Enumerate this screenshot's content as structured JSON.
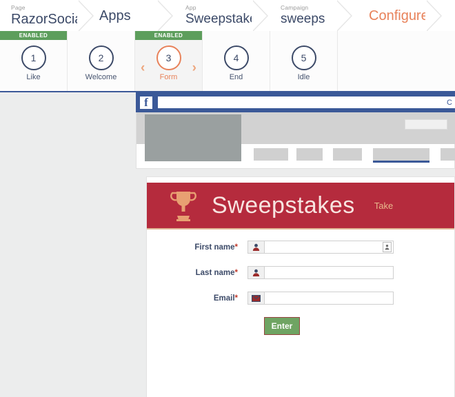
{
  "breadcrumb": {
    "items": [
      {
        "sub": "Page",
        "label": "RazorSocial",
        "style": "normal"
      },
      {
        "sub": "",
        "label": "Apps",
        "style": "normal"
      },
      {
        "sub": "App",
        "label": "Sweepstakes",
        "style": "normal"
      },
      {
        "sub": "Campaign",
        "label": "sweeps",
        "style": "normal"
      },
      {
        "sub": "",
        "label": "Configure",
        "style": "orange"
      }
    ]
  },
  "steps": {
    "enabled_badge": "ENABLED",
    "prev_arrow": "‹",
    "next_arrow": "›",
    "items": [
      {
        "number": "1",
        "label": "Like",
        "enabled": true,
        "active": false
      },
      {
        "number": "2",
        "label": "Welcome",
        "enabled": false,
        "active": false
      },
      {
        "number": "3",
        "label": "Form",
        "enabled": true,
        "active": true
      },
      {
        "number": "4",
        "label": "End",
        "enabled": false,
        "active": false
      },
      {
        "number": "5",
        "label": "Idle",
        "enabled": false,
        "active": false
      }
    ]
  },
  "facebook": {
    "logo": "f",
    "search_placeholder": "",
    "search_trailing_text": "C",
    "tabs_count": 5
  },
  "app": {
    "title": "Sweepstakes",
    "tagline": "Take",
    "trophy_icon": "trophy-icon",
    "form": {
      "fields": [
        {
          "label": "First name",
          "required": "*",
          "value": "",
          "placeholder": "",
          "icon": "person-icon",
          "has_contact_picker": true
        },
        {
          "label": "Last name",
          "required": "*",
          "value": "",
          "placeholder": "",
          "icon": "person-icon",
          "has_contact_picker": false
        },
        {
          "label": "Email",
          "required": "*",
          "value": "",
          "placeholder": "",
          "icon": "envelope-icon",
          "has_contact_picker": false
        }
      ],
      "submit_label": "Enter"
    }
  },
  "colors": {
    "facebook_blue": "#3b5998",
    "banner_red": "#b52b3d",
    "accent_orange": "#e8825a",
    "enabled_green": "#5d9e5c",
    "submit_green": "#6fa463",
    "navy": "#3c4a68"
  }
}
